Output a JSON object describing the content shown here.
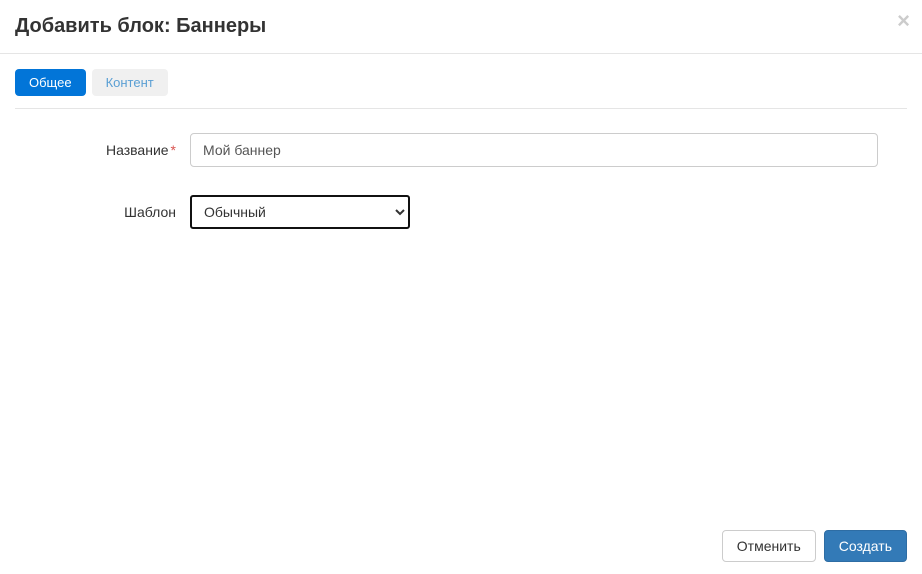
{
  "header": {
    "title": "Добавить блок: Баннеры"
  },
  "tabs": {
    "general": "Общее",
    "content": "Контент"
  },
  "form": {
    "name_label": "Название",
    "name_value": "Мой баннер",
    "template_label": "Шаблон",
    "template_selected": "Обычный"
  },
  "footer": {
    "cancel": "Отменить",
    "create": "Создать"
  }
}
